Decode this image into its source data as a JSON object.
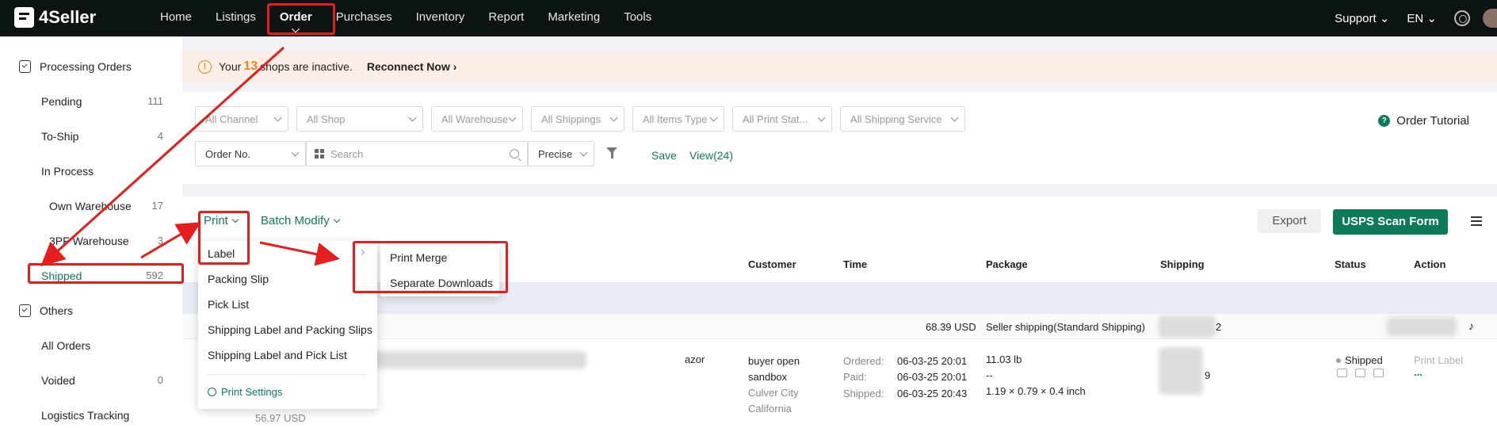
{
  "app": {
    "logo": "4Seller"
  },
  "nav": {
    "items": [
      "Home",
      "Listings",
      "Order",
      "Purchases",
      "Inventory",
      "Report",
      "Marketing",
      "Tools"
    ],
    "active": "Order"
  },
  "topbar": {
    "support": "Support",
    "language": "EN"
  },
  "sidebar": {
    "group1": "Processing Orders",
    "items": [
      {
        "label": "Pending",
        "count": "111"
      },
      {
        "label": "To-Ship",
        "count": "4"
      },
      {
        "label": "In Process",
        "count": ""
      },
      {
        "label": "Own Warehouse",
        "count": "17"
      },
      {
        "label": "3PF Warehouse",
        "count": "3"
      },
      {
        "label": "Shipped",
        "count": "592"
      }
    ],
    "group2": "Others",
    "others": [
      {
        "label": "All Orders",
        "count": ""
      },
      {
        "label": "Voided",
        "count": "0"
      },
      {
        "label": "Logistics Tracking",
        "count": ""
      }
    ]
  },
  "banner": {
    "prefix": "Your",
    "count": "13",
    "suffix": "shops are inactive.",
    "link": "Reconnect Now"
  },
  "filters": {
    "selects": [
      "All Channel",
      "All Shop",
      "All Warehouse",
      "All Shippings",
      "All Items Type",
      "All Print Stat...",
      "All Shipping Service"
    ],
    "search_field": "Order No.",
    "search_placeholder": "Search",
    "match_mode": "Precise",
    "save": "Save",
    "view": "View(24)",
    "tutorial": "Order Tutorial"
  },
  "toolbar": {
    "print": "Print",
    "batch_modify": "Batch Modify",
    "export": "Export",
    "usps": "USPS Scan Form"
  },
  "table": {
    "headers": {
      "customer": "Customer",
      "time": "Time",
      "package": "Package",
      "shipping": "Shipping",
      "status": "Status",
      "action": "Action"
    },
    "summary": {
      "amount": "68.39 USD",
      "shipping_method": "Seller shipping(Standard Shipping)",
      "partial": "2"
    },
    "row": {
      "product_frag": "azor",
      "customer": [
        "buyer open",
        "sandbox"
      ],
      "city": "Culver City",
      "state": "California",
      "ordered_label": "Ordered:",
      "ordered": "06-03-25 20:01",
      "paid_label": "Paid:",
      "paid": "06-03-25 20:01",
      "shipped_label": "Shipped:",
      "shipped": "06-03-25 20:43",
      "weight": "11.03 lb",
      "dash": "--",
      "dims": "1.19 × 0.79 × 0.4 inch",
      "ship_frag": "9",
      "status": "Shipped",
      "print_label": "Print Label",
      "more": "...",
      "price": "56.97 USD"
    }
  },
  "print_menu": {
    "items": [
      "Label",
      "Packing Slip",
      "Pick List",
      "Shipping Label and Packing Slips",
      "Shipping Label and Pick List"
    ],
    "settings": "Print Settings"
  },
  "label_submenu": [
    "Print Merge",
    "Separate Downloads"
  ],
  "colors": {
    "accent": "#0e7a5c",
    "annotation": "#e51d1d",
    "warning": "#e98a1b"
  }
}
